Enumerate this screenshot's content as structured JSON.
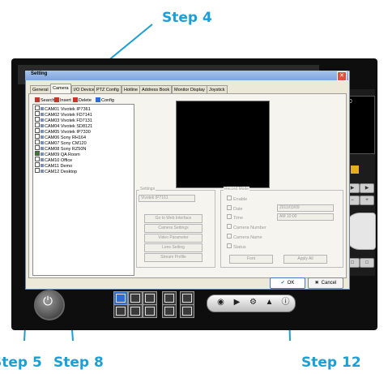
{
  "callouts": {
    "step4": "Step 4",
    "step5": "Step 5",
    "step8": "Step 8",
    "step12": "Step 12",
    "accent_color": "#1a9fd6"
  },
  "dialog": {
    "title": "Setting",
    "close_icon": "close-icon",
    "tabs": [
      "General",
      "Camera",
      "I/O Device",
      "PTZ Config",
      "Hotline",
      "Address Book",
      "Monitor Display",
      "Joystick"
    ],
    "active_tab": "Camera",
    "toolbar": {
      "search_label": "Search",
      "insert_label": "Insert",
      "delete_label": "Delete",
      "config_label": "Config"
    },
    "cameras": [
      {
        "label": "CAM01 Vivotek IP7361",
        "checked": false
      },
      {
        "label": "CAM02 Vivotek FD7141",
        "checked": false
      },
      {
        "label": "CAM03 Vivotek FD7131",
        "checked": false
      },
      {
        "label": "CAM04 Vivotek SD8121",
        "checked": false
      },
      {
        "label": "CAM05 Vivotek IP7330",
        "checked": false
      },
      {
        "label": "CAM06 Sony RH164",
        "checked": false
      },
      {
        "label": "CAM07 Sony CM120",
        "checked": false
      },
      {
        "label": "CAM08 Sony RZ50N",
        "checked": false
      },
      {
        "label": "CAM09 QA Room",
        "checked": true
      },
      {
        "label": "CAM10 Office",
        "checked": false
      },
      {
        "label": "CAM11 Demo",
        "checked": false
      },
      {
        "label": "CAM12 Desktop",
        "checked": false
      }
    ],
    "settings_group": {
      "label": "Settings",
      "model_value": "Vivotek IP7161",
      "buttons": [
        "Go to Web Interface",
        "Camera Settings",
        "Video Parameter",
        "Lens Setting",
        "Stream Profile"
      ]
    },
    "record_group": {
      "label": "Record Mode",
      "options": [
        {
          "label": "Enable",
          "checked": true
        },
        {
          "label": "Date",
          "checked": false,
          "value": "2011/03/09"
        },
        {
          "label": "Time",
          "checked": false,
          "value": "AM 10:00"
        },
        {
          "label": "Camera Number",
          "checked": true
        },
        {
          "label": "Camera Name",
          "checked": true
        },
        {
          "label": "Status",
          "checked": false
        }
      ],
      "font_button": "Font",
      "apply_button": "Apply All"
    },
    "ok_label": "OK",
    "cancel_label": "Cancel"
  },
  "app": {
    "right_cam_label": "20"
  }
}
